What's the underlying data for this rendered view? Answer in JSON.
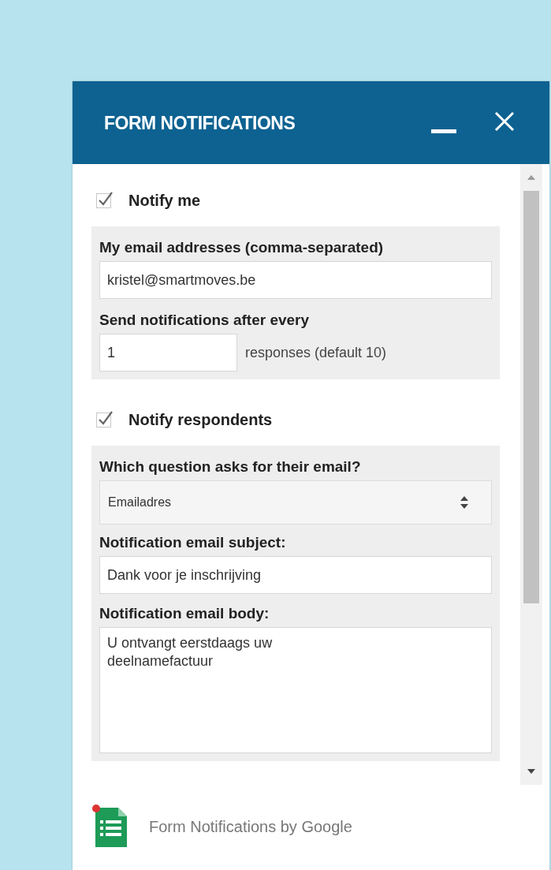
{
  "header": {
    "title": "FORM NOTIFICATIONS"
  },
  "notify_me": {
    "label": "Notify me",
    "checked": true,
    "email_label": "My email addresses (comma-separated)",
    "email_value": "kristel@smartmoves.be",
    "frequency_label": "Send notifications after every",
    "frequency_value": "1",
    "frequency_suffix": "responses (default 10)"
  },
  "notify_respondents": {
    "label": "Notify respondents",
    "checked": true,
    "question_label": "Which question asks for their email?",
    "question_value": "Emailadres",
    "subject_label": "Notification email subject:",
    "subject_value": "Dank voor je inschrijving",
    "body_label": "Notification email body:",
    "body_value": "U ontvangt eerstdaags uw\ndeelnamefactuur"
  },
  "footer": {
    "text": "Form Notifications by Google"
  }
}
